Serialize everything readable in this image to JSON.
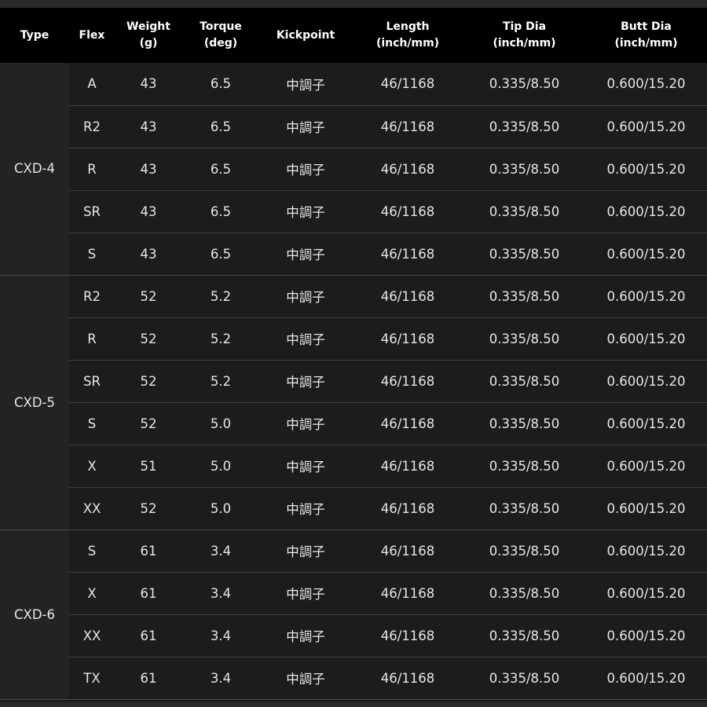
{
  "headers": [
    "Type",
    "Flex",
    "Weight\n(g)",
    "Torque\n(deg)",
    "Kickpoint",
    "Length\n(inch/mm)",
    "Tip Dia\n(inch/mm)",
    "Butt Dia\n(inch/mm)"
  ],
  "groups": [
    {
      "type": "CXD-4",
      "rows": [
        {
          "flex": "A",
          "weight": "43",
          "torque": "6.5",
          "kickpoint": "中調子",
          "length": "46/1168",
          "tip": "0.335/8.50",
          "butt": "0.600/15.20"
        },
        {
          "flex": "R2",
          "weight": "43",
          "torque": "6.5",
          "kickpoint": "中調子",
          "length": "46/1168",
          "tip": "0.335/8.50",
          "butt": "0.600/15.20"
        },
        {
          "flex": "R",
          "weight": "43",
          "torque": "6.5",
          "kickpoint": "中調子",
          "length": "46/1168",
          "tip": "0.335/8.50",
          "butt": "0.600/15.20"
        },
        {
          "flex": "SR",
          "weight": "43",
          "torque": "6.5",
          "kickpoint": "中調子",
          "length": "46/1168",
          "tip": "0.335/8.50",
          "butt": "0.600/15.20"
        },
        {
          "flex": "S",
          "weight": "43",
          "torque": "6.5",
          "kickpoint": "中調子",
          "length": "46/1168",
          "tip": "0.335/8.50",
          "butt": "0.600/15.20"
        }
      ]
    },
    {
      "type": "CXD-5",
      "rows": [
        {
          "flex": "R2",
          "weight": "52",
          "torque": "5.2",
          "kickpoint": "中調子",
          "length": "46/1168",
          "tip": "0.335/8.50",
          "butt": "0.600/15.20"
        },
        {
          "flex": "R",
          "weight": "52",
          "torque": "5.2",
          "kickpoint": "中調子",
          "length": "46/1168",
          "tip": "0.335/8.50",
          "butt": "0.600/15.20"
        },
        {
          "flex": "SR",
          "weight": "52",
          "torque": "5.2",
          "kickpoint": "中調子",
          "length": "46/1168",
          "tip": "0.335/8.50",
          "butt": "0.600/15.20"
        },
        {
          "flex": "S",
          "weight": "52",
          "torque": "5.0",
          "kickpoint": "中調子",
          "length": "46/1168",
          "tip": "0.335/8.50",
          "butt": "0.600/15.20"
        },
        {
          "flex": "X",
          "weight": "51",
          "torque": "5.0",
          "kickpoint": "中調子",
          "length": "46/1168",
          "tip": "0.335/8.50",
          "butt": "0.600/15.20"
        },
        {
          "flex": "XX",
          "weight": "52",
          "torque": "5.0",
          "kickpoint": "中調子",
          "length": "46/1168",
          "tip": "0.335/8.50",
          "butt": "0.600/15.20"
        }
      ]
    },
    {
      "type": "CXD-6",
      "rows": [
        {
          "flex": "S",
          "weight": "61",
          "torque": "3.4",
          "kickpoint": "中調子",
          "length": "46/1168",
          "tip": "0.335/8.50",
          "butt": "0.600/15.20"
        },
        {
          "flex": "X",
          "weight": "61",
          "torque": "3.4",
          "kickpoint": "中調子",
          "length": "46/1168",
          "tip": "0.335/8.50",
          "butt": "0.600/15.20"
        },
        {
          "flex": "XX",
          "weight": "61",
          "torque": "3.4",
          "kickpoint": "中調子",
          "length": "46/1168",
          "tip": "0.335/8.50",
          "butt": "0.600/15.20"
        },
        {
          "flex": "TX",
          "weight": "61",
          "torque": "3.4",
          "kickpoint": "中調子",
          "length": "46/1168",
          "tip": "0.335/8.50",
          "butt": "0.600/15.20"
        }
      ]
    }
  ]
}
